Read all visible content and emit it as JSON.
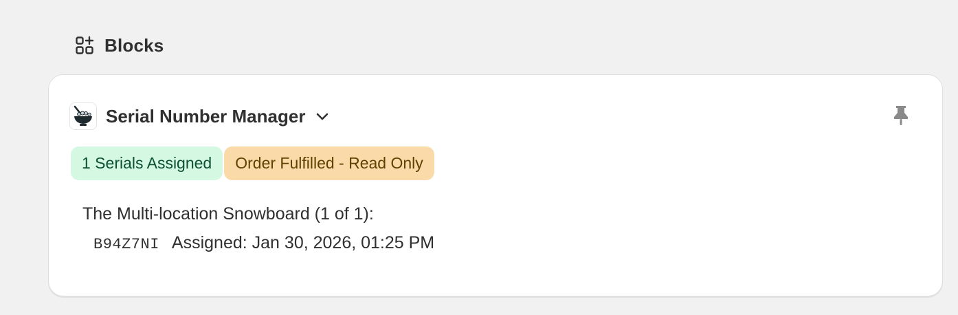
{
  "section": {
    "title": "Blocks",
    "icon": "blocks-add-icon"
  },
  "app": {
    "name": "Serial Number Manager",
    "logo_icon": "rice-bowl-icon",
    "pin_icon": "pin-icon",
    "menu_icon": "chevron-down-icon"
  },
  "badges": {
    "serials_assigned": "1 Serials Assigned",
    "order_status": "Order Fulfilled - Read Only"
  },
  "items": [
    {
      "product_line": "The Multi-location Snowboard (1 of 1):",
      "serial": "B94Z7NI",
      "assigned": "Assigned: Jan 30, 2026, 01:25 PM"
    }
  ],
  "colors": {
    "page_bg": "#f1f1f1",
    "card_bg": "#ffffff",
    "success_badge_bg": "#d4f8e2",
    "success_badge_text": "#0c5132",
    "warning_badge_bg": "#fbdaa9",
    "warning_badge_text": "#5e4200",
    "text": "#303030",
    "icon_muted": "#8a8a8a"
  }
}
